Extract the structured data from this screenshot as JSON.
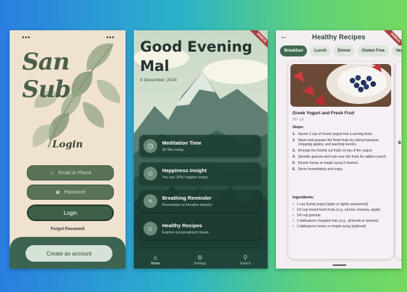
{
  "login": {
    "logo_text": "San Sub",
    "title": "Login",
    "email_placeholder": "Email or Phone",
    "password_placeholder": "Password",
    "login_button": "Login",
    "forgot_link": "Forgot Password",
    "create_account_button": "Create an account"
  },
  "home": {
    "greeting": "Good Evening Mal",
    "date": "4 December, 2024",
    "debug_badge": "DEBUG",
    "cards": [
      {
        "title": "Meditation Time",
        "subtitle": "35 Min today",
        "icon": "clock-icon"
      },
      {
        "title": "Happiness Insight",
        "subtitle": "You are 30% happier today",
        "icon": "smile-icon"
      },
      {
        "title": "Breathing Reminder",
        "subtitle": "Remember to breathe deeply!",
        "icon": "air-icon"
      },
      {
        "title": "Healthy Recipes",
        "subtitle": "Explore personalized meals",
        "icon": "home-icon"
      }
    ],
    "nav": [
      {
        "label": "Home",
        "icon": "home-icon"
      },
      {
        "label": "Settings",
        "icon": "gear-icon"
      },
      {
        "label": "Search",
        "icon": "search-icon"
      }
    ]
  },
  "recipes": {
    "title": "Healthy Recipes",
    "debug_badge": "DEBUG",
    "chips": [
      "Breakfast",
      "Lunch",
      "Dinner",
      "Gluten Free",
      "Vegan"
    ],
    "selected_chip": "Breakfast",
    "recipe": {
      "name": "Greek Yogurt and Fresh Fruit",
      "calories": "567 cal",
      "steps_heading": "Steps:",
      "steps": [
        "Spoon 1 cup of Greek yogurt into a serving bowl.",
        "Wash and prepare the fresh fruits by slicing bananas, chopping apples, and washing berries.",
        "Arrange the freshly cut fruits on top of the yogurt.",
        "Sprinkle granola and nuts over the fruits for added crunch.",
        "Drizzle honey or maple syrup if desired.",
        "Serve immediately and enjoy."
      ],
      "ingredients_heading": "Ingredients:",
      "ingredients": [
        "1 cup Greek yogurt (plain or lightly sweetened)",
        "1/2 cup mixed fresh fruits (e.g., berries, banana, apple)",
        "1/4 cup granola",
        "1 tablespoon chopped nuts (e.g., almonds or walnuts)",
        "1 tablespoon honey or maple syrup (optional)"
      ]
    },
    "next_card_peek": {
      "name": "S",
      "steps_heading": "S"
    }
  },
  "colors": {
    "accent_green": "#3e6a52",
    "login_bg": "#efe2cf",
    "card_bg": "#1e3e32"
  }
}
